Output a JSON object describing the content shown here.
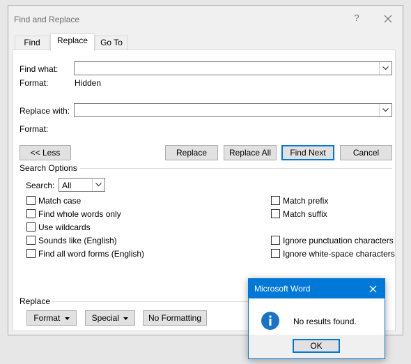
{
  "window": {
    "title": "Find and Replace",
    "help": "?"
  },
  "tabs": [
    {
      "label": "Find",
      "active": false
    },
    {
      "label": "Replace",
      "active": true
    },
    {
      "label": "Go To",
      "active": false
    }
  ],
  "find": {
    "label": "Find what:",
    "value": "",
    "format_label": "Format:",
    "format_value": "Hidden"
  },
  "replace": {
    "label": "Replace with:",
    "value": "",
    "format_label": "Format:",
    "format_value": ""
  },
  "buttons": {
    "less": "<< Less",
    "replace": "Replace",
    "replace_all": "Replace All",
    "find_next": "Find Next",
    "cancel": "Cancel"
  },
  "search_options": {
    "title": "Search Options",
    "search_label": "Search:",
    "search_value": "All",
    "left": [
      {
        "label": "Match case",
        "checked": false
      },
      {
        "label": "Find whole words only",
        "checked": false
      },
      {
        "label": "Use wildcards",
        "checked": false
      },
      {
        "label": "Sounds like (English)",
        "checked": false
      },
      {
        "label": "Find all word forms (English)",
        "checked": false
      }
    ],
    "right": [
      {
        "label": "Match prefix",
        "checked": false
      },
      {
        "label": "Match suffix",
        "checked": false
      },
      {
        "label": "Ignore punctuation characters",
        "checked": false
      },
      {
        "label": "Ignore white-space characters",
        "checked": false
      }
    ]
  },
  "replace_section": {
    "title": "Replace",
    "format_btn": "Format",
    "special_btn": "Special",
    "no_formatting_btn": "No Formatting"
  },
  "message_box": {
    "title": "Microsoft Word",
    "message": "No results found.",
    "ok": "OK",
    "icon": "info-icon"
  },
  "colors": {
    "accent": "#0078d7",
    "dialog_bg": "#f0f0f0"
  }
}
